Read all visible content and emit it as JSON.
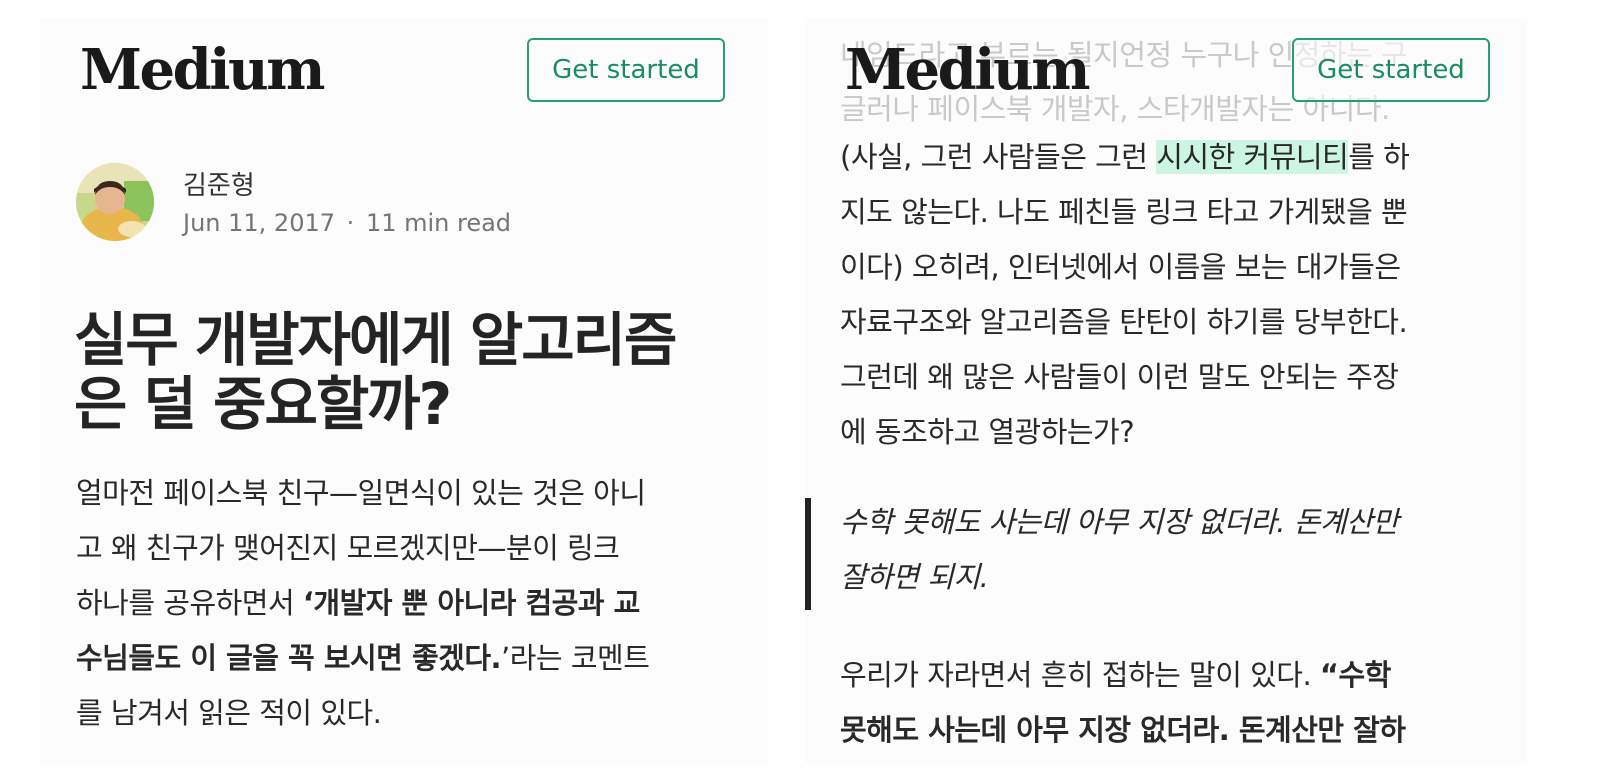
{
  "left": {
    "logo": "Medium",
    "cta": "Get started",
    "author": "김준형",
    "date": "Jun 11, 2017",
    "dot": "·",
    "read_time": "11 min read",
    "title_lines": [
      "실무 개발자에게 알고리즘",
      "은 덜 중요할까?"
    ],
    "body": {
      "l1": "얼마전 페이스북 친구—일면식이 있는 것은 아니",
      "l2": "고 왜 친구가 맺어진지 모르겠지만—분이 링크",
      "l3a": "하나를 공유하면서 ",
      "l3b": "‘개발자 뿐 아니라 컴공과 교",
      "l4a": "수님들도 이 글을 꼭 보시면 좋겠다.",
      "l4b": "’라는 코멘트",
      "l5": "를 남겨서 읽은 적이 있다."
    }
  },
  "right": {
    "logo": "Medium",
    "cta": "Get started",
    "ghost_lines": [
      "네임드라고 부르는 될지언정 누구나 인정하는 구",
      "글러나 페이스북 개발자, 스타개발자는 아니다."
    ],
    "para1": {
      "l1a": "(사실, 그런 사람들은 그런 ",
      "l1b": "시시한 커뮤니티",
      "l1c": "를 하",
      "l2": "지도 않는다. 나도 페친들 링크 타고 가게됐을 뿐",
      "l3": "이다) 오히려, 인터넷에서 이름을 보는 대가들은",
      "l4": "자료구조와 알고리즘을 탄탄이 하기를 당부한다.",
      "l5": "그런데 왜 많은 사람들이 이런 말도 안되는 주장",
      "l6": "에 동조하고 열광하는가?"
    },
    "quote": {
      "l1": "수학 못해도 사는데 아무 지장 없더라. 돈계산만",
      "l2": "잘하면 되지."
    },
    "para2": {
      "l1a": "우리가 자라면서 흔히 접하는 말이 있다. ",
      "l1b": "“수학",
      "l2": "못해도 사는데 아무 지장 없더라. 돈계산만 잘하"
    }
  },
  "colors": {
    "accent": "#1a8d5c",
    "highlight": "#cdf5e3",
    "text": "#292929",
    "muted": "#757575"
  }
}
